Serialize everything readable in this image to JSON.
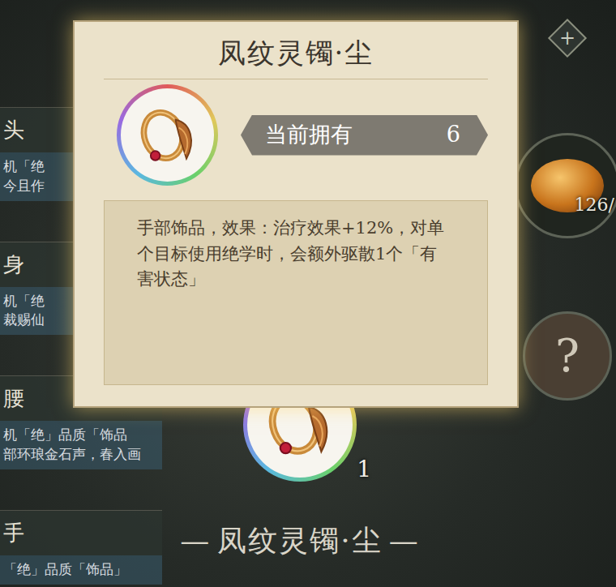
{
  "tooltip": {
    "title": "凤纹灵镯·尘",
    "owned_label": "当前拥有",
    "owned_count": "6",
    "description": "手部饰品，效果：治疗效果+12%，对单个目标使用绝学时，会额外驱散1个「有害状态」"
  },
  "slots": [
    {
      "label": "头",
      "lines": [
        "机「绝",
        "今且作"
      ]
    },
    {
      "label": "身",
      "lines": [
        "机「绝",
        "裁赐仙"
      ]
    },
    {
      "label": "腰",
      "lines": [
        "机「绝」品质「饰品",
        "部环琅金石声，春入画"
      ]
    },
    {
      "label": "手",
      "lines": [
        "「绝」品质「饰品」"
      ]
    }
  ],
  "add_button": {
    "label": "+"
  },
  "resource": {
    "count": "126/"
  },
  "unknown_slot": {
    "label": "?"
  },
  "item": {
    "count": "1",
    "left_mark": "—",
    "name": "凤纹灵镯·尘",
    "right_mark": "—"
  }
}
